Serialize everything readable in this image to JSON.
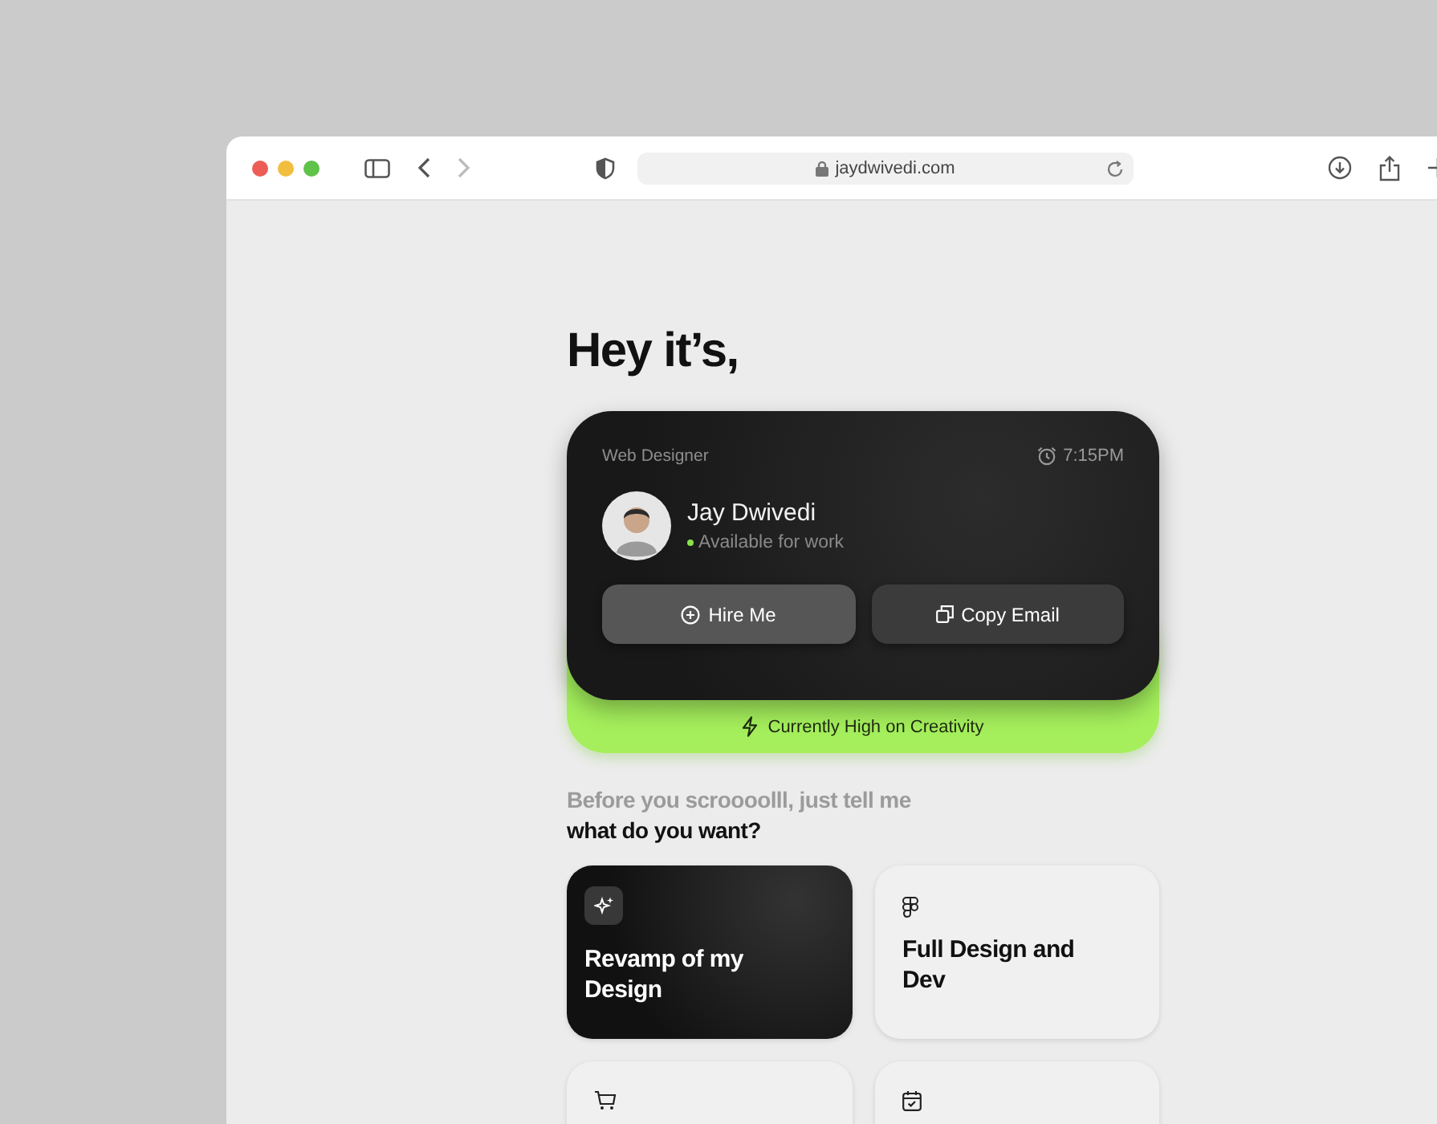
{
  "browser": {
    "address": "jaydwivedi.com"
  },
  "heading": "Hey it’s,",
  "profile": {
    "role": "Web Designer",
    "time": "7:15PM",
    "name": "Jay Dwivedi",
    "status": "Available for work",
    "available": true,
    "buttons": [
      "Hire Me",
      "Copy Email"
    ],
    "mood": "Currently High on Creativity"
  },
  "question": {
    "lead": "Before you scroooolll, just tell me",
    "prompt": "what do you want?"
  },
  "options": [
    {
      "title": "Revamp of my Design",
      "selected": true
    },
    {
      "title": "Full Design and Dev",
      "selected": false
    },
    {
      "selected": false
    },
    {
      "selected": false
    }
  ]
}
